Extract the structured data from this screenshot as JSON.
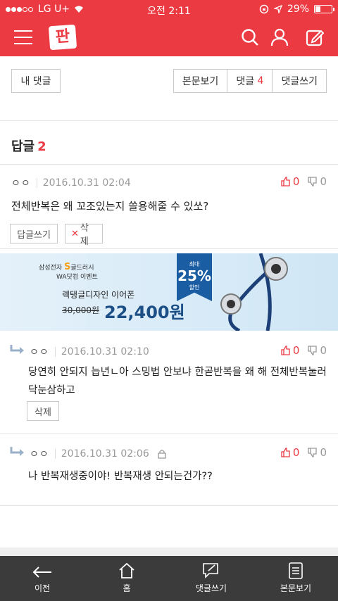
{
  "status": {
    "carrier": "LG U+",
    "time": "오전 2:11",
    "battery": "29%"
  },
  "toolbar": {
    "my_comments": "내 댓글",
    "view_post": "본문보기",
    "comments_label": "댓글",
    "comments_count": "4",
    "write_comment": "댓글쓰기"
  },
  "replies": {
    "title": "답글",
    "count": "2"
  },
  "comments": [
    {
      "nick": "ㅇㅇ",
      "date": "2016.10.31 02:04",
      "up": "0",
      "down": "0",
      "text": "전체반복은 왜 꼬조있는지 쓸용해줄 수 있쏘?",
      "reply_btn": "답글쓰기",
      "delete_btn": "삭제"
    },
    {
      "nick": "ㅇㅇ",
      "date": "2016.10.31 02:10",
      "up": "0",
      "down": "0",
      "text": "당연히 안되지 늡년ㄴ아 스밍법 안보냐 한곧반복을 왜 해 전체반복눌러 닥눈삼하고",
      "delete_btn": "삭제"
    },
    {
      "nick": "ㅇㅇ",
      "date": "2016.10.31 02:06",
      "up": "0",
      "down": "0",
      "text": "나 반복재생중이야! 반복재생 안되는건가??"
    }
  ],
  "ad": {
    "brand_prefix": "삼성전자",
    "brand": "S",
    "brand_suffix": "글드러시",
    "event": "WA닷컴 이벤트",
    "product": "렉탱글디자인 이어폰",
    "old_price": "30,000원",
    "new_price": "22,400원",
    "disc_top": "최대",
    "disc_pct": "25%",
    "disc_bottom": "할인"
  },
  "nav": {
    "back": "이전",
    "home": "홈",
    "write": "댓글쓰기",
    "view": "본문보기"
  },
  "colors": {
    "accent": "#ec3a43",
    "nav_bg": "#3b3b3b"
  }
}
